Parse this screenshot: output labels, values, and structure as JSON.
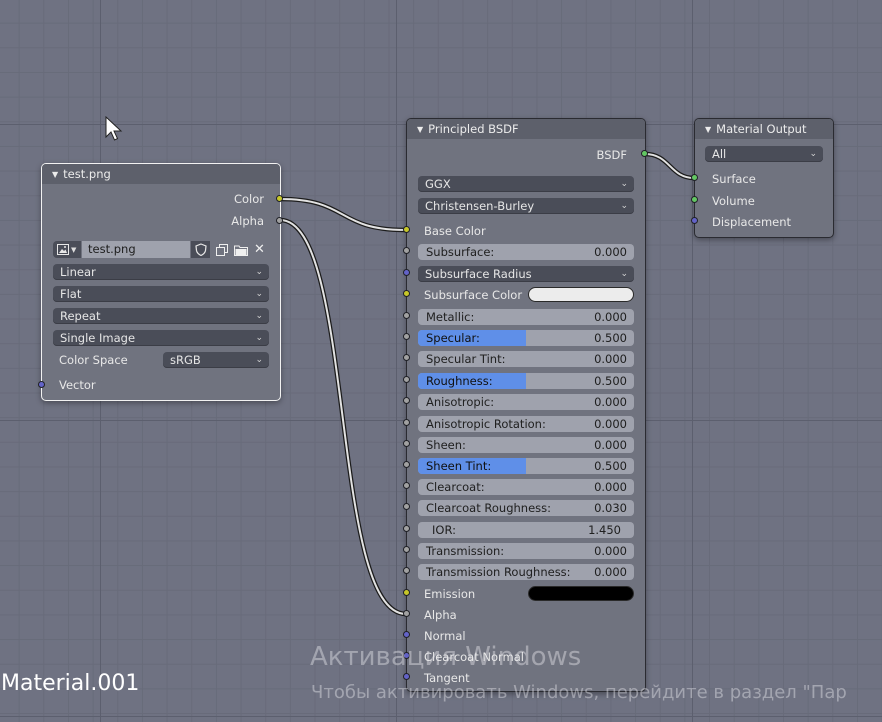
{
  "image_node": {
    "title": "test.png",
    "outputs": {
      "color": "Color",
      "alpha": "Alpha"
    },
    "image_name": "test.png",
    "interpolation": "Linear",
    "projection": "Flat",
    "extension": "Repeat",
    "source": "Single Image",
    "color_space_label": "Color Space",
    "color_space": "sRGB",
    "inputs": {
      "vector": "Vector"
    }
  },
  "bsdf_node": {
    "title": "Principled BSDF",
    "output": "BSDF",
    "distribution": "GGX",
    "subsurface_method": "Christensen-Burley",
    "base_color": "Base Color",
    "subsurface": {
      "label": "Subsurface:",
      "value": "0.000"
    },
    "subsurface_radius": "Subsurface Radius",
    "subsurface_color": "Subsurface Color",
    "metallic": {
      "label": "Metallic:",
      "value": "0.000"
    },
    "specular": {
      "label": "Specular:",
      "value": "0.500",
      "fraction": 0.5
    },
    "specular_tint": {
      "label": "Specular Tint:",
      "value": "0.000"
    },
    "roughness": {
      "label": "Roughness:",
      "value": "0.500",
      "fraction": 0.5
    },
    "anisotropic": {
      "label": "Anisotropic:",
      "value": "0.000"
    },
    "anisotropic_rotation": {
      "label": "Anisotropic Rotation:",
      "value": "0.000"
    },
    "sheen": {
      "label": "Sheen:",
      "value": "0.000"
    },
    "sheen_tint": {
      "label": "Sheen Tint:",
      "value": "0.500",
      "fraction": 0.5
    },
    "clearcoat": {
      "label": "Clearcoat:",
      "value": "0.000"
    },
    "clearcoat_roughness": {
      "label": "Clearcoat Roughness:",
      "value": "0.030"
    },
    "ior": {
      "label": "IOR:",
      "value": "1.450"
    },
    "transmission": {
      "label": "Transmission:",
      "value": "0.000"
    },
    "transmission_roughness": {
      "label": "Transmission Roughness:",
      "value": "0.000"
    },
    "emission": "Emission",
    "alpha": "Alpha",
    "normal": "Normal",
    "clearcoat_normal": "Clearcoat Normal",
    "tangent": "Tangent",
    "subsurface_color_value": "#ececec",
    "emission_color_value": "#000000"
  },
  "output_node": {
    "title": "Material Output",
    "target": "All",
    "surface": "Surface",
    "volume": "Volume",
    "displacement": "Displacement"
  },
  "material_name": "Material.001",
  "watermark": {
    "title": "Активация Windows",
    "subtitle": "Чтобы активировать Windows, перейдите в раздел \"Пар"
  },
  "icons": [
    "image-browse-icon",
    "chevron-down-icon",
    "fake-user-shield-icon",
    "duplicate-icon",
    "open-folder-icon",
    "close-icon",
    "collapse-arrow-icon",
    "mouse-cursor-icon"
  ],
  "colors": {
    "socket_color": "#c7c729",
    "socket_float": "#a1a1a1",
    "socket_vector": "#6363c7",
    "socket_shader": "#63c763",
    "slider_fill": "#5f8fe8"
  }
}
